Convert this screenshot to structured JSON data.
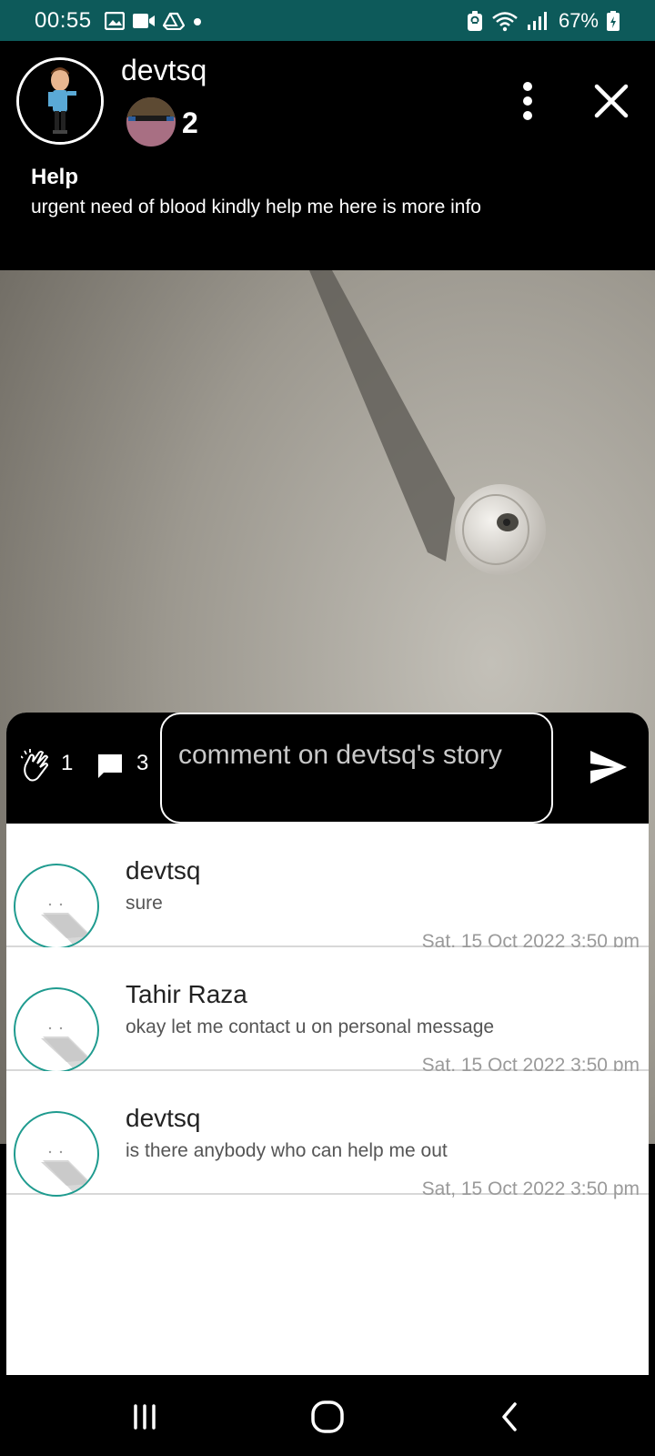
{
  "status_bar": {
    "time": "00:55",
    "battery": "67%",
    "icons_left": [
      "gallery-icon",
      "video-icon",
      "drive-icon",
      "dot-icon"
    ],
    "icons_right": [
      "battery-saver-icon",
      "wifi-icon",
      "signal-icon",
      "battery-icon"
    ],
    "background": "#0d5a5a"
  },
  "story": {
    "username": "devtsq",
    "viewer_count": "2",
    "title": "Help",
    "text": "urgent need of blood kindly help me here is more info"
  },
  "actions": {
    "clap_count": "1",
    "comment_count": "3",
    "comment_placeholder": "comment on devtsq's story"
  },
  "comments": [
    {
      "name": "devtsq",
      "text": "sure",
      "time": "Sat, 15 Oct 2022 3:50 pm"
    },
    {
      "name": "Tahir Raza",
      "text": "okay let me contact u on personal message",
      "time": "Sat, 15 Oct 2022 3:50 pm"
    },
    {
      "name": "devtsq",
      "text": "is there anybody who can help me out",
      "time": "Sat, 15 Oct 2022 3:50 pm"
    }
  ],
  "colors": {
    "avatar_ring": "#1f9b8f",
    "panel_bg": "#ffffff",
    "header_bg": "#000000"
  },
  "nav": [
    "recent-apps-icon",
    "home-icon",
    "back-icon"
  ]
}
